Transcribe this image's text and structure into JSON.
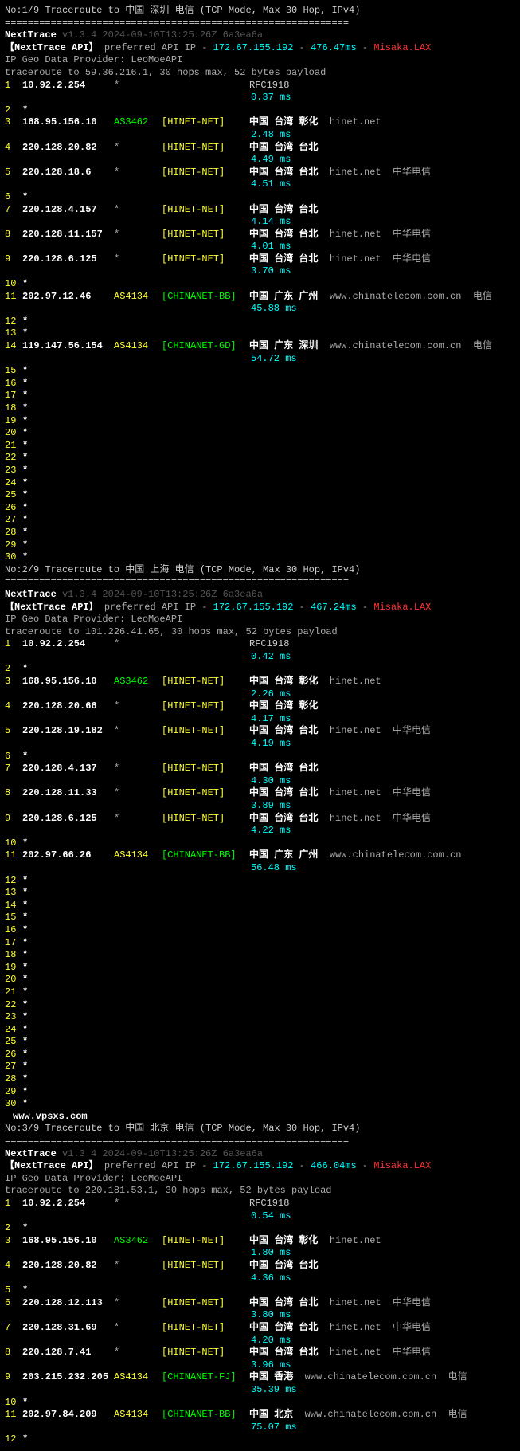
{
  "divider": "============================================================",
  "nexttrace": "NextTrace",
  "version": "v1.3.4 2024-09-10T13:25:26Z 6a3ea6a",
  "api_label": "【NextTrace API】",
  "api_text1": "preferred API IP -",
  "api_ip": "172.67.155.192",
  "api_dash": "-",
  "api_sep": "-",
  "misaka": "Misaka.LAX",
  "geo": "IP Geo Data Provider: LeoMoeAPI",
  "rfc": "RFC1918",
  "watermark": "www.vpsxs.com",
  "traces": [
    {
      "title": "No:1/9 Traceroute to 中国 深圳 电信 (TCP Mode, Max 30 Hop, IPv4)",
      "api_ms": "476.47ms",
      "target": "traceroute to 59.36.216.1, 30 hops max, 52 bytes payload",
      "hops": [
        {
          "n": "1",
          "ip": "10.92.2.254",
          "asn": "*",
          "net": "",
          "rfc": true,
          "rtt": "0.37 ms"
        },
        {
          "n": "2",
          "ip": "*"
        },
        {
          "n": "3",
          "ip": "168.95.156.10",
          "asn": "AS3462",
          "asnc": "green",
          "net": "[HINET-NET]",
          "netc": "yellow",
          "loc": "中国 台湾 彰化",
          "dom": "hinet.net",
          "rtt": "2.48 ms"
        },
        {
          "n": "4",
          "ip": "220.128.20.82",
          "asn": "*",
          "net": "[HINET-NET]",
          "netc": "yellow",
          "loc": "中国 台湾 台北",
          "rtt": "4.49 ms"
        },
        {
          "n": "5",
          "ip": "220.128.18.6",
          "asn": "*",
          "net": "[HINET-NET]",
          "netc": "yellow",
          "loc": "中国 台湾 台北",
          "dom": "hinet.net",
          "isp": "中华电信",
          "rtt": "4.51 ms"
        },
        {
          "n": "6",
          "ip": "*"
        },
        {
          "n": "7",
          "ip": "220.128.4.157",
          "asn": "*",
          "net": "[HINET-NET]",
          "netc": "yellow",
          "loc": "中国 台湾 台北",
          "rtt": "4.14 ms"
        },
        {
          "n": "8",
          "ip": "220.128.11.157",
          "asn": "*",
          "net": "[HINET-NET]",
          "netc": "yellow",
          "loc": "中国 台湾 台北",
          "dom": "hinet.net",
          "isp": "中华电信",
          "rtt": "4.01 ms"
        },
        {
          "n": "9",
          "ip": "220.128.6.125",
          "asn": "*",
          "net": "[HINET-NET]",
          "netc": "yellow",
          "loc": "中国 台湾 台北",
          "dom": "hinet.net",
          "isp": "中华电信",
          "rtt": "3.70 ms"
        },
        {
          "n": "10",
          "ip": "*"
        },
        {
          "n": "11",
          "ip": "202.97.12.46",
          "asn": "AS4134",
          "asnc": "yellow",
          "net": "[CHINANET-BB]",
          "netc": "green",
          "loc": "中国 广东 广州",
          "dom": "www.chinatelecom.com.cn",
          "isp": "电信",
          "rtt": "45.88 ms"
        },
        {
          "n": "12",
          "ip": "*"
        },
        {
          "n": "13",
          "ip": "*"
        },
        {
          "n": "14",
          "ip": "119.147.56.154",
          "asn": "AS4134",
          "asnc": "yellow",
          "net": "[CHINANET-GD]",
          "netc": "green",
          "loc": "中国 广东 深圳",
          "dom": "www.chinatelecom.com.cn",
          "isp": "电信",
          "rtt": "54.72 ms"
        },
        {
          "n": "15",
          "ip": "*"
        },
        {
          "n": "16",
          "ip": "*"
        },
        {
          "n": "17",
          "ip": "*"
        },
        {
          "n": "18",
          "ip": "*"
        },
        {
          "n": "19",
          "ip": "*"
        },
        {
          "n": "20",
          "ip": "*"
        },
        {
          "n": "21",
          "ip": "*"
        },
        {
          "n": "22",
          "ip": "*"
        },
        {
          "n": "23",
          "ip": "*"
        },
        {
          "n": "24",
          "ip": "*"
        },
        {
          "n": "25",
          "ip": "*"
        },
        {
          "n": "26",
          "ip": "*"
        },
        {
          "n": "27",
          "ip": "*"
        },
        {
          "n": "28",
          "ip": "*"
        },
        {
          "n": "29",
          "ip": "*"
        },
        {
          "n": "30",
          "ip": "*"
        }
      ]
    },
    {
      "title": "No:2/9 Traceroute to 中国 上海 电信 (TCP Mode, Max 30 Hop, IPv4)",
      "api_ms": "467.24ms",
      "target": "traceroute to 101.226.41.65, 30 hops max, 52 bytes payload",
      "hops": [
        {
          "n": "1",
          "ip": "10.92.2.254",
          "asn": "*",
          "net": "",
          "rfc": true,
          "rtt": "0.42 ms"
        },
        {
          "n": "2",
          "ip": "*"
        },
        {
          "n": "3",
          "ip": "168.95.156.10",
          "asn": "AS3462",
          "asnc": "green",
          "net": "[HINET-NET]",
          "netc": "yellow",
          "loc": "中国 台湾 彰化",
          "dom": "hinet.net",
          "rtt": "2.26 ms"
        },
        {
          "n": "4",
          "ip": "220.128.20.66",
          "asn": "*",
          "net": "[HINET-NET]",
          "netc": "yellow",
          "loc": "中国 台湾 彰化",
          "rtt": "4.17 ms"
        },
        {
          "n": "5",
          "ip": "220.128.19.182",
          "asn": "*",
          "net": "[HINET-NET]",
          "netc": "yellow",
          "loc": "中国 台湾 台北",
          "dom": "hinet.net",
          "isp": "中华电信",
          "rtt": "4.19 ms"
        },
        {
          "n": "6",
          "ip": "*"
        },
        {
          "n": "7",
          "ip": "220.128.4.137",
          "asn": "*",
          "net": "[HINET-NET]",
          "netc": "yellow",
          "loc": "中国 台湾 台北",
          "rtt": "4.30 ms"
        },
        {
          "n": "8",
          "ip": "220.128.11.33",
          "asn": "*",
          "net": "[HINET-NET]",
          "netc": "yellow",
          "loc": "中国 台湾 台北",
          "dom": "hinet.net",
          "isp": "中华电信",
          "rtt": "3.89 ms"
        },
        {
          "n": "9",
          "ip": "220.128.6.125",
          "asn": "*",
          "net": "[HINET-NET]",
          "netc": "yellow",
          "loc": "中国 台湾 台北",
          "dom": "hinet.net",
          "isp": "中华电信",
          "rtt": "4.22 ms"
        },
        {
          "n": "10",
          "ip": "*"
        },
        {
          "n": "11",
          "ip": "202.97.66.26",
          "asn": "AS4134",
          "asnc": "yellow",
          "net": "[CHINANET-BB]",
          "netc": "green",
          "loc": "中国 广东 广州",
          "dom": "www.chinatelecom.com.cn",
          "rtt": "56.48 ms"
        },
        {
          "n": "12",
          "ip": "*"
        },
        {
          "n": "13",
          "ip": "*"
        },
        {
          "n": "14",
          "ip": "*"
        },
        {
          "n": "15",
          "ip": "*"
        },
        {
          "n": "16",
          "ip": "*"
        },
        {
          "n": "17",
          "ip": "*"
        },
        {
          "n": "18",
          "ip": "*"
        },
        {
          "n": "19",
          "ip": "*"
        },
        {
          "n": "20",
          "ip": "*"
        },
        {
          "n": "21",
          "ip": "*"
        },
        {
          "n": "22",
          "ip": "*"
        },
        {
          "n": "23",
          "ip": "*"
        },
        {
          "n": "24",
          "ip": "*"
        },
        {
          "n": "25",
          "ip": "*"
        },
        {
          "n": "26",
          "ip": "*"
        },
        {
          "n": "27",
          "ip": "*"
        },
        {
          "n": "28",
          "ip": "*"
        },
        {
          "n": "29",
          "ip": "*"
        },
        {
          "n": "30",
          "ip": "*"
        }
      ]
    },
    {
      "title": "No:3/9 Traceroute to 中国 北京 电信 (TCP Mode, Max 30 Hop, IPv4)",
      "api_ms": "466.04ms",
      "target": "traceroute to 220.181.53.1, 30 hops max, 52 bytes payload",
      "watermark_before": true,
      "hops": [
        {
          "n": "1",
          "ip": "10.92.2.254",
          "asn": "*",
          "net": "",
          "rfc": true,
          "rtt": "0.54 ms"
        },
        {
          "n": "2",
          "ip": "*"
        },
        {
          "n": "3",
          "ip": "168.95.156.10",
          "asn": "AS3462",
          "asnc": "green",
          "net": "[HINET-NET]",
          "netc": "yellow",
          "loc": "中国 台湾 彰化",
          "dom": "hinet.net",
          "rtt": "1.80 ms"
        },
        {
          "n": "4",
          "ip": "220.128.20.82",
          "asn": "*",
          "net": "[HINET-NET]",
          "netc": "yellow",
          "loc": "中国 台湾 台北",
          "rtt": "4.36 ms"
        },
        {
          "n": "5",
          "ip": "*"
        },
        {
          "n": "6",
          "ip": "220.128.12.113",
          "asn": "*",
          "net": "[HINET-NET]",
          "netc": "yellow",
          "loc": "中国 台湾 台北",
          "dom": "hinet.net",
          "isp": "中华电信",
          "rtt": "3.80 ms"
        },
        {
          "n": "7",
          "ip": "220.128.31.69",
          "asn": "*",
          "net": "[HINET-NET]",
          "netc": "yellow",
          "loc": "中国 台湾 台北",
          "dom": "hinet.net",
          "isp": "中华电信",
          "rtt": "4.20 ms"
        },
        {
          "n": "8",
          "ip": "220.128.7.41",
          "asn": "*",
          "net": "[HINET-NET]",
          "netc": "yellow",
          "loc": "中国 台湾 台北",
          "dom": "hinet.net",
          "isp": "中华电信",
          "rtt": "3.96 ms"
        },
        {
          "n": "9",
          "ip": "203.215.232.205",
          "asn": "AS4134",
          "asnc": "yellow",
          "net": "[CHINANET-FJ]",
          "netc": "green",
          "loc": "中国 香港",
          "dom": "www.chinatelecom.com.cn",
          "isp": "电信",
          "rtt": "35.39 ms"
        },
        {
          "n": "10",
          "ip": "*"
        },
        {
          "n": "11",
          "ip": "202.97.84.209",
          "asn": "AS4134",
          "asnc": "yellow",
          "net": "[CHINANET-BB]",
          "netc": "green",
          "loc": "中国 北京",
          "dom": "www.chinatelecom.com.cn",
          "isp": "电信",
          "rtt": "75.07 ms"
        },
        {
          "n": "12",
          "ip": "*"
        }
      ]
    }
  ]
}
